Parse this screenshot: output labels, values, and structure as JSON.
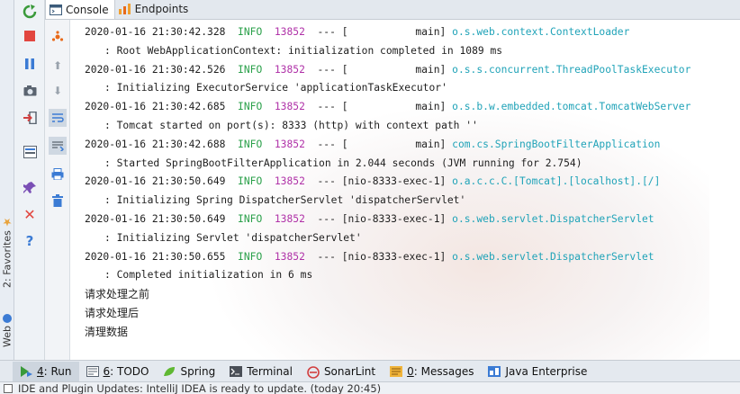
{
  "favorites_strip": {
    "favorites_label": "2: Favorites",
    "web_label": "Web"
  },
  "tabs": [
    {
      "label": "Console"
    },
    {
      "label": "Endpoints"
    }
  ],
  "log_lines": [
    {
      "ts": "2020-01-16 21:30:42.328",
      "level": "INFO",
      "pid": "13852",
      "sep": "--- [",
      "thread": "           main]",
      "logger": "o.s.web.context.ContextLoader",
      "msg": ": Root WebApplicationContext: initialization completed in 1089 ms"
    },
    {
      "ts": "2020-01-16 21:30:42.526",
      "level": "INFO",
      "pid": "13852",
      "sep": "--- [",
      "thread": "           main]",
      "logger": "o.s.s.concurrent.ThreadPoolTaskExecutor",
      "msg": ": Initializing ExecutorService 'applicationTaskExecutor'"
    },
    {
      "ts": "2020-01-16 21:30:42.685",
      "level": "INFO",
      "pid": "13852",
      "sep": "--- [",
      "thread": "           main]",
      "logger": "o.s.b.w.embedded.tomcat.TomcatWebServer",
      "msg": ": Tomcat started on port(s): 8333 (http) with context path ''"
    },
    {
      "ts": "2020-01-16 21:30:42.688",
      "level": "INFO",
      "pid": "13852",
      "sep": "--- [",
      "thread": "           main]",
      "logger": "com.cs.SpringBootFilterApplication",
      "msg": ": Started SpringBootFilterApplication in 2.044 seconds (JVM running for 2.754)"
    },
    {
      "ts": "2020-01-16 21:30:50.649",
      "level": "INFO",
      "pid": "13852",
      "sep": "--- ",
      "thread": "[nio-8333-exec-1]",
      "logger": "o.a.c.c.C.[Tomcat].[localhost].[/]",
      "msg": ": Initializing Spring DispatcherServlet 'dispatcherServlet'"
    },
    {
      "ts": "2020-01-16 21:30:50.649",
      "level": "INFO",
      "pid": "13852",
      "sep": "--- ",
      "thread": "[nio-8333-exec-1]",
      "logger": "o.s.web.servlet.DispatcherServlet",
      "msg": ": Initializing Servlet 'dispatcherServlet'"
    },
    {
      "ts": "2020-01-16 21:30:50.655",
      "level": "INFO",
      "pid": "13852",
      "sep": "--- ",
      "thread": "[nio-8333-exec-1]",
      "logger": "o.s.web.servlet.DispatcherServlet",
      "msg": ": Completed initialization in 6 ms"
    }
  ],
  "plain_lines": [
    "请求处理之前",
    "请求处理后",
    "清理数据"
  ],
  "bottom_tools": [
    {
      "label_prefix": "",
      "mnemonic": "4",
      "label": ": Run",
      "icon": "run-icon"
    },
    {
      "label_prefix": "",
      "mnemonic": "6",
      "label": ": TODO",
      "icon": "todo-icon"
    },
    {
      "label_prefix": "",
      "mnemonic": "",
      "label": "Spring",
      "icon": "spring-icon"
    },
    {
      "label_prefix": "",
      "mnemonic": "",
      "label": "Terminal",
      "icon": "terminal-icon"
    },
    {
      "label_prefix": "",
      "mnemonic": "",
      "label": "SonarLint",
      "icon": "sonarlint-icon"
    },
    {
      "label_prefix": "",
      "mnemonic": "0",
      "label": ": Messages",
      "icon": "messages-icon"
    },
    {
      "label_prefix": "",
      "mnemonic": "",
      "label": "Java Enterprise",
      "icon": "java-enterprise-icon"
    }
  ],
  "status": {
    "text": "IDE and Plugin Updates: IntelliJ IDEA is ready to update. (today 20:45)"
  }
}
